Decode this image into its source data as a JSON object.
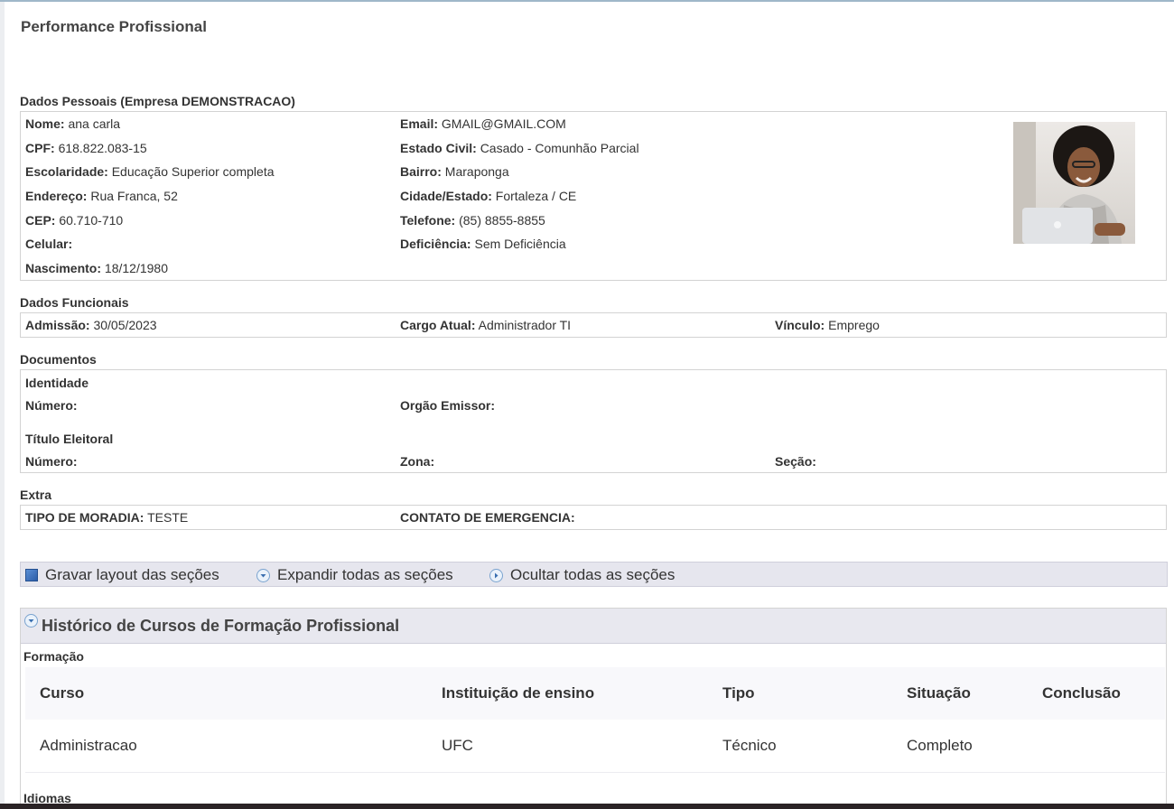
{
  "page_title": "Performance Profissional",
  "pessoais": {
    "title": "Dados Pessoais (Empresa DEMONSTRACAO)",
    "col1": [
      {
        "label": "Nome:",
        "value": "ana carla"
      },
      {
        "label": "CPF:",
        "value": "618.822.083-15"
      },
      {
        "label": "Escolaridade:",
        "value": "Educação Superior completa"
      },
      {
        "label": "Endereço:",
        "value": "Rua Franca, 52"
      },
      {
        "label": "CEP:",
        "value": "60.710-710"
      },
      {
        "label": "Celular:",
        "value": ""
      },
      {
        "label": "Nascimento:",
        "value": "18/12/1980"
      }
    ],
    "col2": [
      {
        "label": "Email:",
        "value": "GMAIL@GMAIL.COM"
      },
      {
        "label": "Estado Civil:",
        "value": "Casado - Comunhão Parcial"
      },
      {
        "label": "Bairro:",
        "value": "Maraponga"
      },
      {
        "label": "Cidade/Estado:",
        "value": "Fortaleza / CE"
      },
      {
        "label": "Telefone:",
        "value": "(85) 8855-8855"
      },
      {
        "label": "Deficiência:",
        "value": "Sem Deficiência"
      }
    ]
  },
  "funcionais": {
    "title": "Dados Funcionais",
    "fields": [
      {
        "label": "Admissão:",
        "value": "30/05/2023"
      },
      {
        "label": "Cargo Atual:",
        "value": "Administrador TI"
      },
      {
        "label": "Vínculo:",
        "value": "Emprego"
      }
    ]
  },
  "documentos": {
    "title": "Documentos",
    "identidade": {
      "title": "Identidade",
      "fields": [
        {
          "label": "Número:",
          "value": ""
        },
        {
          "label": "Orgão Emissor:",
          "value": ""
        }
      ]
    },
    "titulo": {
      "title": "Título Eleitoral",
      "fields": [
        {
          "label": "Número:",
          "value": ""
        },
        {
          "label": "Zona:",
          "value": ""
        },
        {
          "label": "Seção:",
          "value": ""
        }
      ]
    }
  },
  "extra": {
    "title": "Extra",
    "fields": [
      {
        "label": "TIPO DE MORADIA:",
        "value": "TESTE"
      },
      {
        "label": "CONTATO DE EMERGENCIA:",
        "value": ""
      }
    ]
  },
  "toolbar": {
    "save": "Gravar layout das seções",
    "expand": "Expandir todas as seções",
    "hide": "Ocultar todas as seções"
  },
  "historico": {
    "title": "Histórico de Cursos de Formação Profissional",
    "formacao_label": "Formação",
    "columns": [
      "Curso",
      "Instituição de ensino",
      "Tipo",
      "Situação",
      "Conclusão"
    ],
    "rows": [
      [
        "Administracao",
        "UFC",
        "Técnico",
        "Completo",
        ""
      ]
    ],
    "idiomas_label": "Idiomas"
  },
  "colors": {
    "toolbar_bg": "#e6e6ee",
    "panel_header_bg": "#e8e8ef",
    "accent_blue": "#2c5ea8"
  }
}
